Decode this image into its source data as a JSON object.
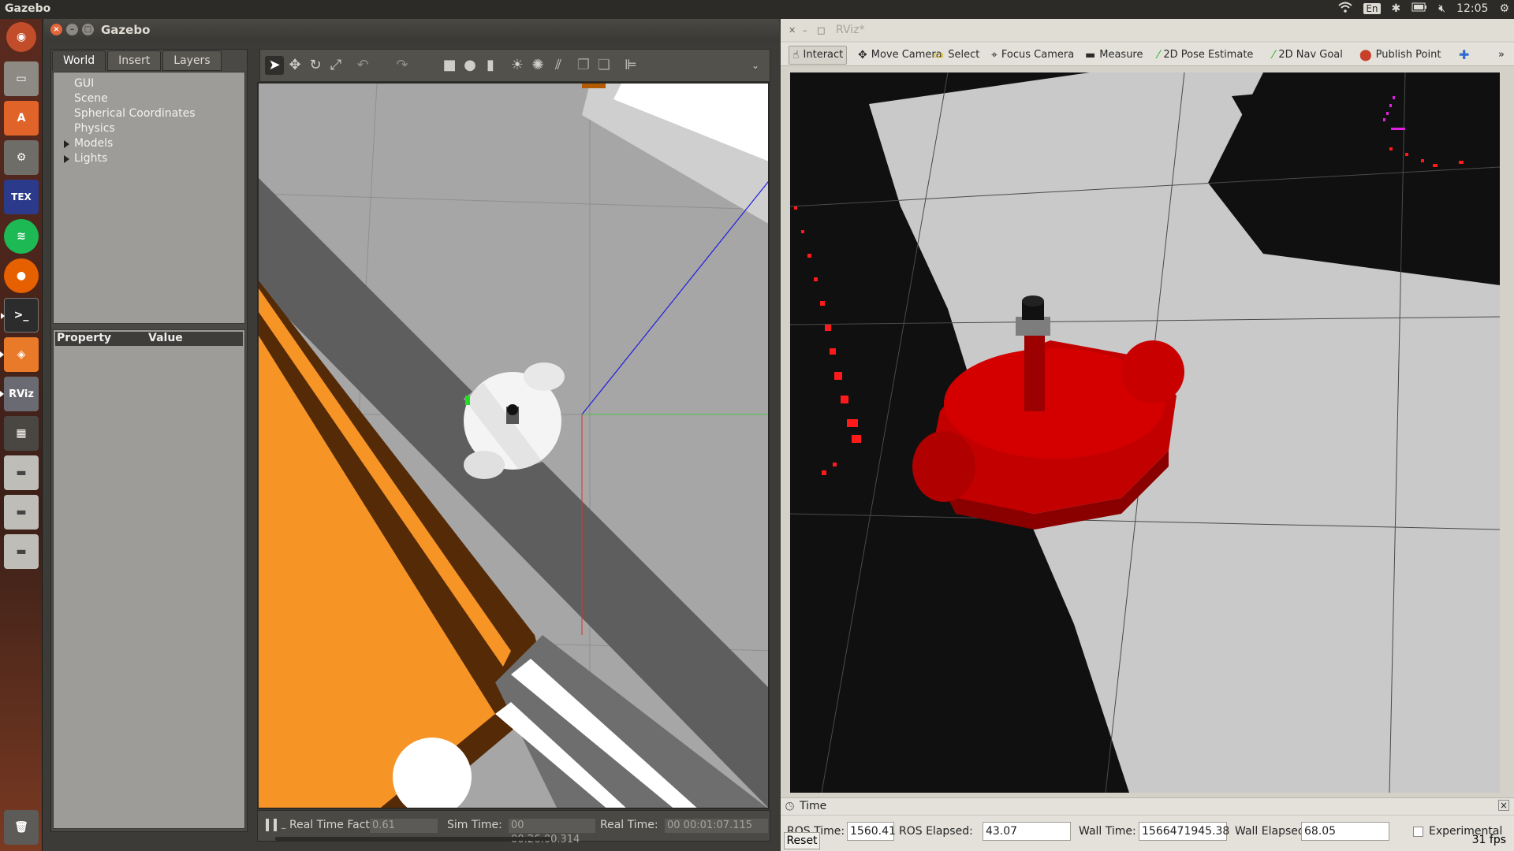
{
  "topbar": {
    "app_title": "Gazebo",
    "keyboard": "En",
    "clock": "12:05"
  },
  "launcher": {
    "items": [
      "ubuntu-dash",
      "files",
      "software-center",
      "system-settings",
      "texmaker",
      "spotify",
      "firefox",
      "terminal",
      "gazebo",
      "rviz",
      "workspace-switcher",
      "drive-1",
      "drive-2",
      "drive-3",
      "trash"
    ],
    "rviz_label": "RViz",
    "tex_label": "TEX"
  },
  "gazebo": {
    "title": "Gazebo",
    "tabs": [
      "World",
      "Insert",
      "Layers"
    ],
    "tree": [
      "GUI",
      "Scene",
      "Spherical Coordinates",
      "Physics",
      "Models",
      "Lights"
    ],
    "props_headers": {
      "property": "Property",
      "value": "Value"
    },
    "status": {
      "rtf_label": "Real Time Factor:",
      "rtf_value": "0.61",
      "sim_label": "Sim Time:",
      "sim_value": "00 00:26:00.314",
      "real_label": "Real Time:",
      "real_value": "00 00:01:07.115",
      "step_hint": "_"
    }
  },
  "rviz": {
    "title": "RViz*",
    "tools": [
      "Interact",
      "Move Camera",
      "Select",
      "Focus Camera",
      "Measure",
      "2D Pose Estimate",
      "2D Nav Goal",
      "Publish Point"
    ],
    "time_panel": {
      "title": "Time",
      "ros_time_label": "ROS Time:",
      "ros_time_value": "1560.41",
      "ros_elapsed_label": "ROS Elapsed:",
      "ros_elapsed_value": "43.07",
      "wall_time_label": "Wall Time:",
      "wall_time_value": "1566471945.38",
      "wall_elapsed_label": "Wall Elapsed:",
      "wall_elapsed_value": "68.05",
      "experimental_label": "Experimental"
    },
    "reset_label": "Reset",
    "fps": "31 fps"
  }
}
